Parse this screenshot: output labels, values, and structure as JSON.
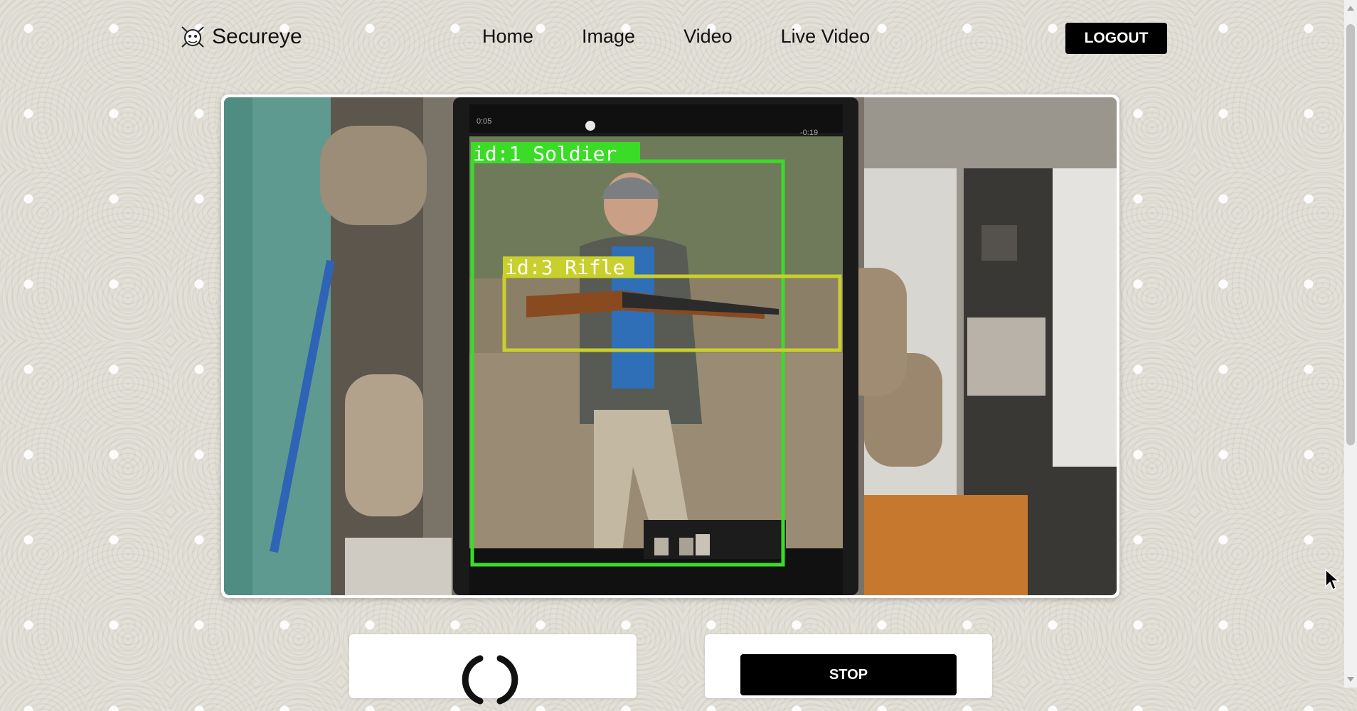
{
  "brand": {
    "name": "Secureye"
  },
  "nav": {
    "items": [
      {
        "label": "Home"
      },
      {
        "label": "Image"
      },
      {
        "label": "Video"
      },
      {
        "label": "Live Video"
      }
    ],
    "logout_label": "LOGOUT"
  },
  "video": {
    "detections": [
      {
        "label": "id:1  Soldier",
        "color": "#3bdc28"
      },
      {
        "label": "id:3  Rifle",
        "color": "#c9cf2c"
      }
    ]
  },
  "controls": {
    "stop_label": "STOP"
  },
  "colors": {
    "button_bg": "#000000",
    "button_text": "#ffffff"
  }
}
